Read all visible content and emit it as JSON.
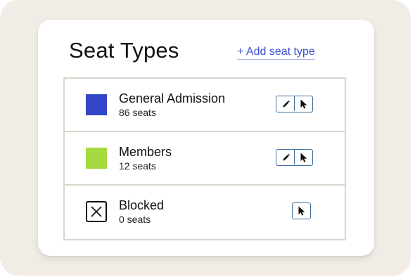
{
  "header": {
    "title": "Seat Types",
    "add_link": "+ Add seat type"
  },
  "colors": {
    "accent_link": "#3a4fd6",
    "icon_button_border": "#3d6f9e"
  },
  "seat_types": [
    {
      "name": "General Admission",
      "count": "86 seats",
      "color": "#3346c8",
      "swatch": "solid",
      "actions": [
        "pencil-icon",
        "cursor-icon"
      ]
    },
    {
      "name": "Members",
      "count": "12 seats",
      "color": "#a4da3e",
      "swatch": "solid",
      "actions": [
        "pencil-icon",
        "cursor-icon"
      ]
    },
    {
      "name": "Blocked",
      "count": "0 seats",
      "color": "#111111",
      "swatch": "x-box",
      "actions": [
        "cursor-icon"
      ]
    }
  ]
}
